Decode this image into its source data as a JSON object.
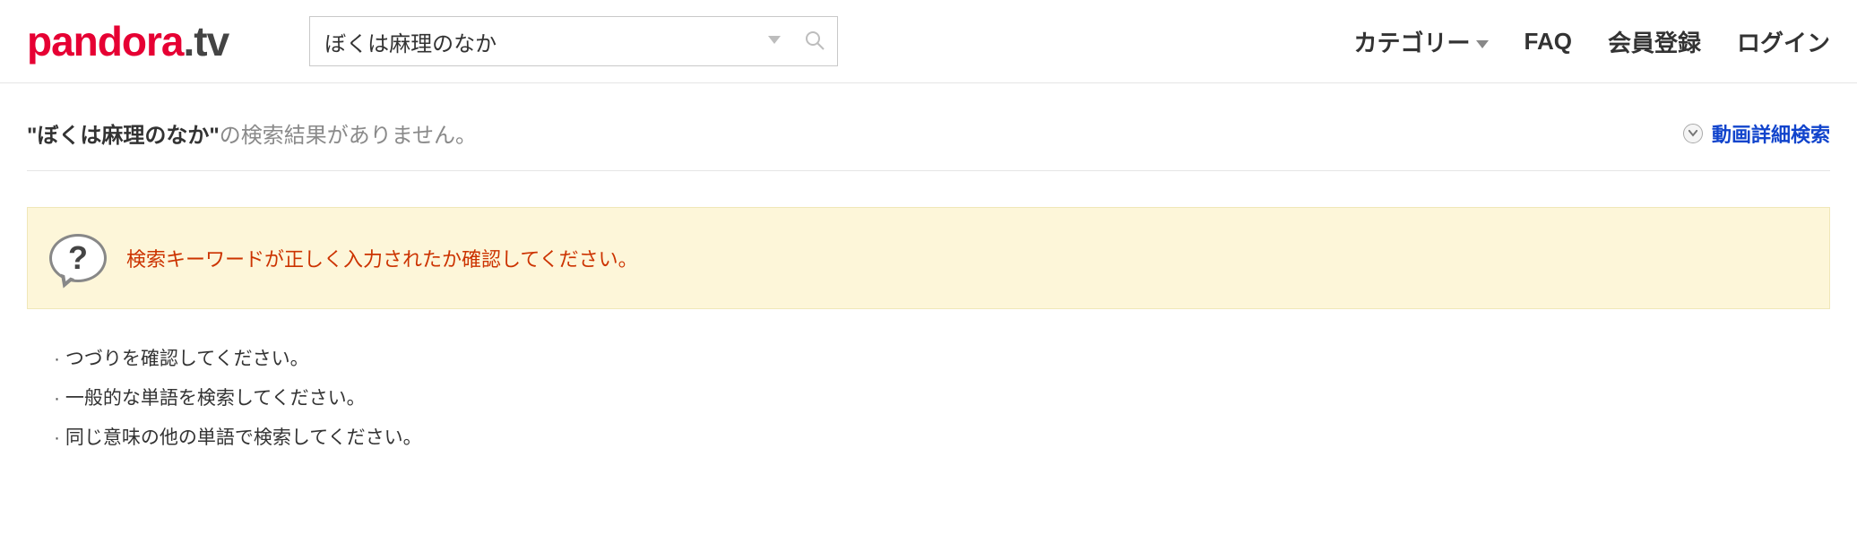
{
  "header": {
    "logo_main": "pandora",
    "logo_suffix": ".tv",
    "search_value": "ぼくは麻理のなか",
    "nav": {
      "category": "カテゴリー",
      "faq": "FAQ",
      "signup": "会員登録",
      "login": "ログイン"
    }
  },
  "result": {
    "query": "ぼくは麻理のなか",
    "no_result_suffix": "の検索結果がありません。",
    "advanced_search": "動画詳細検索"
  },
  "notice": {
    "text": "検索キーワードが正しく入力されたか確認してください。"
  },
  "tips": {
    "items": [
      "つづりを確認してください。",
      "一般的な単語を検索してください。",
      "同じ意味の他の単語で検索してください。"
    ]
  }
}
